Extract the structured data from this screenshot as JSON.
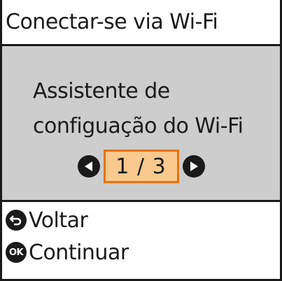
{
  "header": {
    "title": "Conectar-se via Wi-Fi"
  },
  "message": {
    "line1": "Assistente de",
    "line2": "configuação do Wi-Fi"
  },
  "pager": {
    "current": "1",
    "separator": "/",
    "total": "3",
    "prev_icon": "triangle-left-icon",
    "next_icon": "triangle-right-icon"
  },
  "footer": {
    "back_icon": "back-arrow-icon",
    "back_label": "Voltar",
    "ok_icon_text": "OK",
    "ok_label": "Continuar"
  },
  "colors": {
    "content_bg": "#cdcdcd",
    "highlight_border": "#e8720c",
    "highlight_fill": "#f9c98e",
    "foreground": "#1a1a1a"
  }
}
